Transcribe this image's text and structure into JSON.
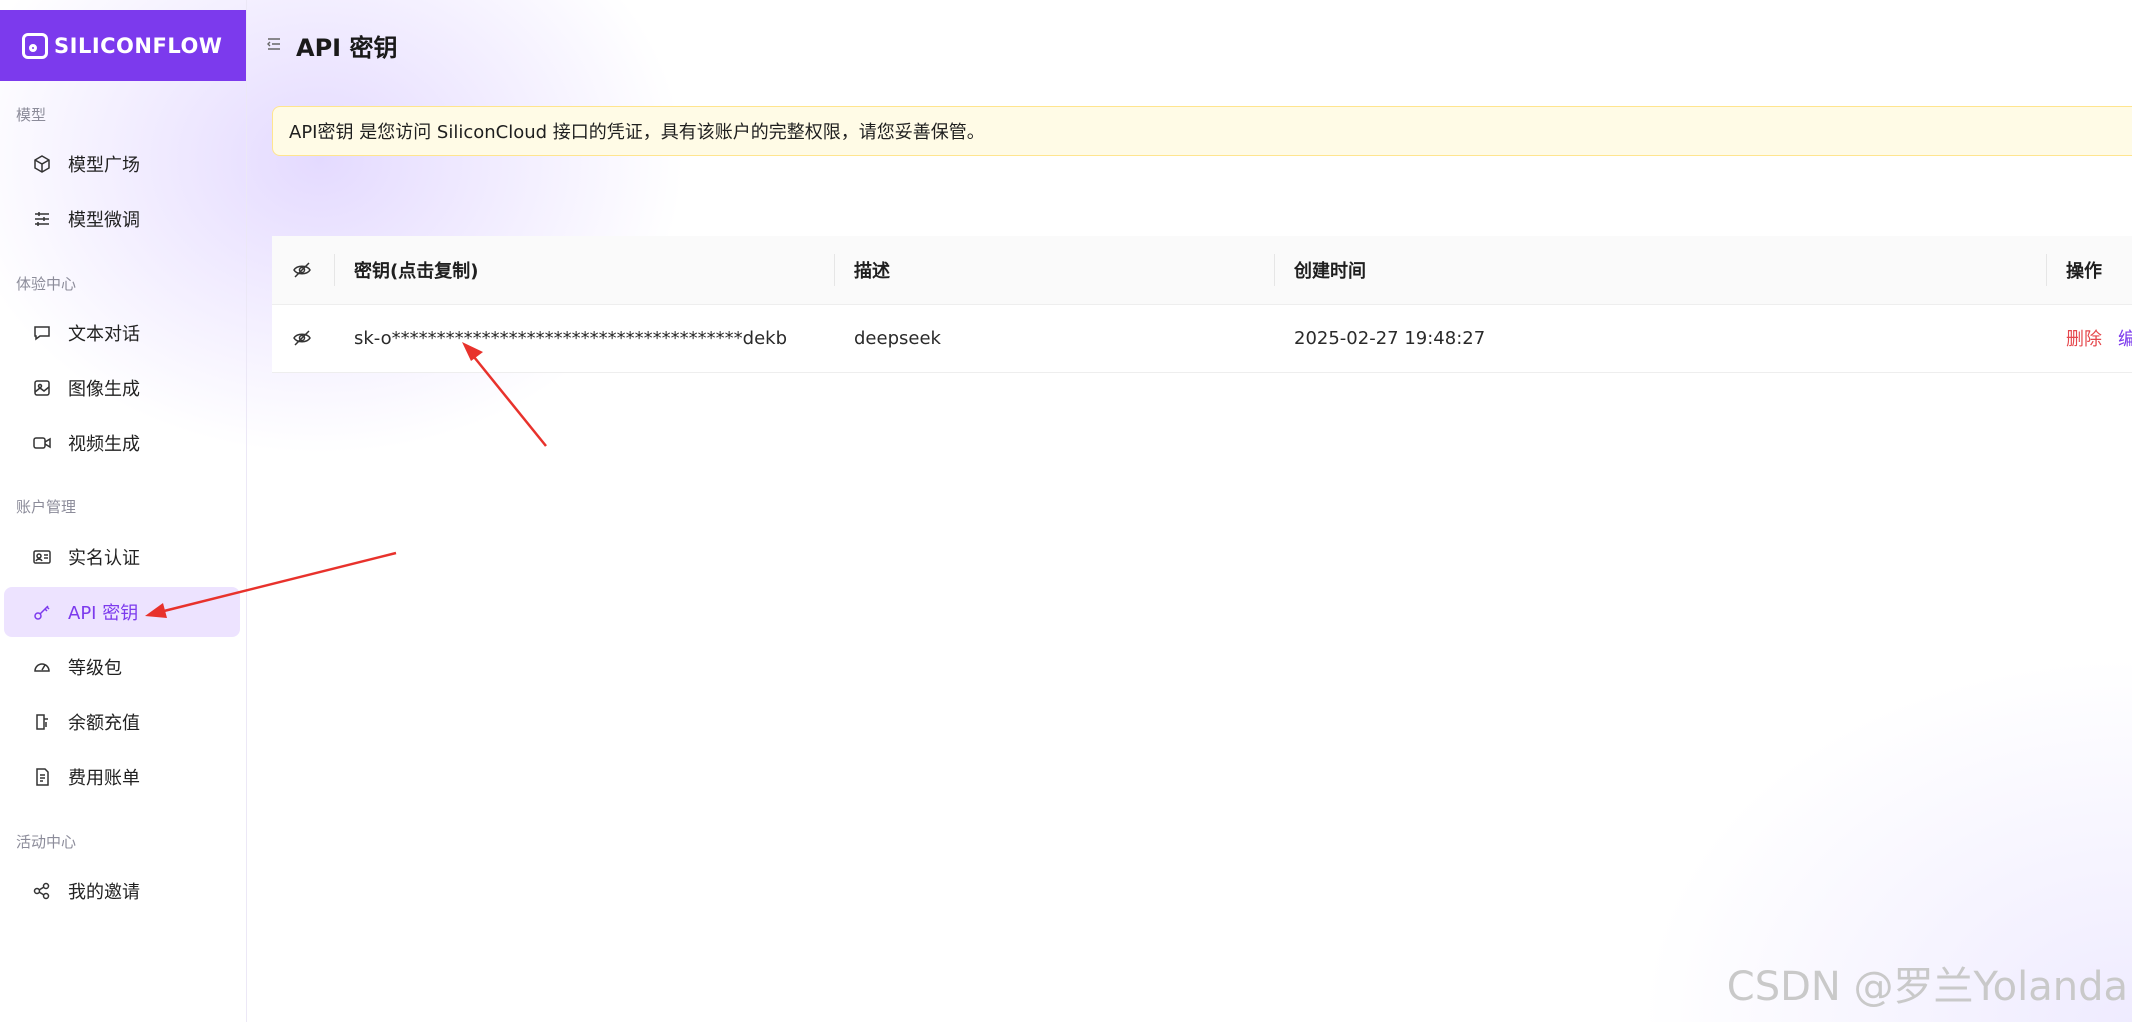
{
  "brand": {
    "name": "SILICONFLOW",
    "color": "#7c3aed"
  },
  "sidebar": {
    "sections": [
      {
        "title": "模型",
        "items": [
          {
            "label": "模型广场",
            "icon": "cube-icon"
          },
          {
            "label": "模型微调",
            "icon": "sliders-icon"
          }
        ]
      },
      {
        "title": "体验中心",
        "items": [
          {
            "label": "文本对话",
            "icon": "chat-bubble-icon"
          },
          {
            "label": "图像生成",
            "icon": "image-icon"
          },
          {
            "label": "视频生成",
            "icon": "video-camera-icon"
          }
        ]
      },
      {
        "title": "账户管理",
        "items": [
          {
            "label": "实名认证",
            "icon": "id-card-icon"
          },
          {
            "label": "API 密钥",
            "icon": "key-icon",
            "active": true
          },
          {
            "label": "等级包",
            "icon": "gauge-icon"
          },
          {
            "label": "余额充值",
            "icon": "wallet-icon"
          },
          {
            "label": "费用账单",
            "icon": "receipt-icon"
          }
        ]
      },
      {
        "title": "活动中心",
        "items": [
          {
            "label": "我的邀请",
            "icon": "share-icon"
          }
        ]
      }
    ]
  },
  "header": {
    "title": "API 密钥"
  },
  "alert": {
    "text": "API密钥 是您访问 SiliconCloud 接口的凭证，具有该账户的完整权限，请您妥善保管。"
  },
  "table": {
    "headers": {
      "key": "密钥(点击复制)",
      "description": "描述",
      "created": "创建时间",
      "actions": "操作"
    },
    "rows": [
      {
        "key": "sk-o***************************************dekb",
        "description": "deepseek",
        "created": "2025-02-27 19:48:27",
        "delete_label": "删除",
        "edit_label": "编"
      }
    ]
  },
  "watermark": "CSDN @罗兰Yolanda",
  "colors": {
    "accent": "#7c3aed",
    "danger": "#e5484d",
    "alert_bg": "#fffbe6",
    "annotation_arrow": "#e8322c"
  }
}
